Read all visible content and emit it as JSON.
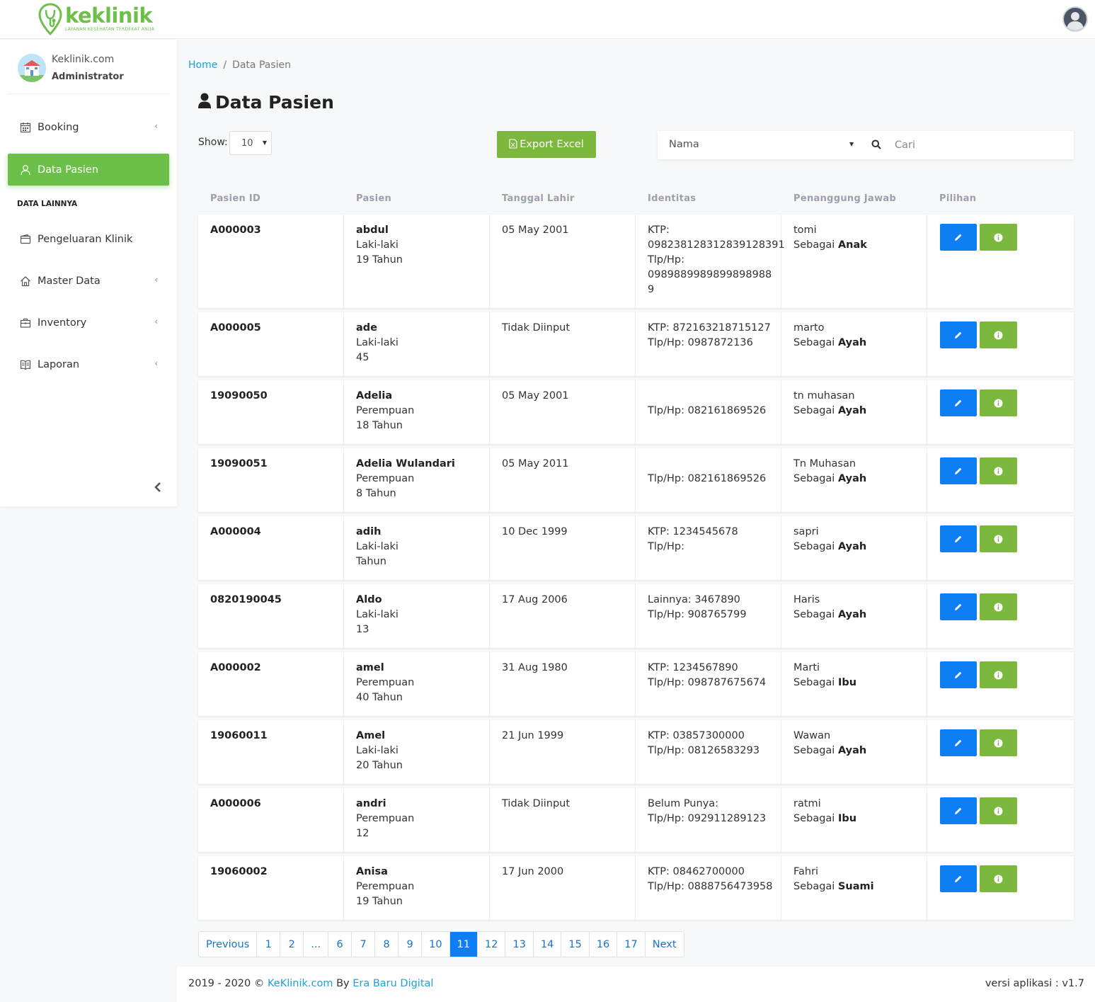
{
  "brand": {
    "name": "keklinik",
    "tagline": "LAYANAN KESEHATAN TERDEKAT ANDA"
  },
  "profile": {
    "name": "Keklinik.com",
    "role": "Administrator"
  },
  "sidebar": {
    "items": [
      {
        "label": "Booking",
        "icon": "calendar-icon",
        "has_chevron": true,
        "active": false
      },
      {
        "label": "Data Pasien",
        "icon": "user-icon",
        "has_chevron": false,
        "active": true
      },
      {
        "label": "Pengeluaran Klinik",
        "icon": "wallet-icon",
        "has_chevron": false,
        "active": false
      },
      {
        "label": "Master Data",
        "icon": "home-icon",
        "has_chevron": true,
        "active": false
      },
      {
        "label": "Inventory",
        "icon": "briefcase-icon",
        "has_chevron": true,
        "active": false
      },
      {
        "label": "Laporan",
        "icon": "book-icon",
        "has_chevron": true,
        "active": false
      }
    ],
    "section_label": "DATA LAINNYA"
  },
  "breadcrumb": {
    "home": "Home",
    "separator": "/",
    "current": "Data Pasien"
  },
  "page_title": "Data Pasien",
  "controls": {
    "show_label": "Show:",
    "show_value": "10",
    "export_label": "Export Excel",
    "search_field": "Nama",
    "search_placeholder": "Cari"
  },
  "table": {
    "headers": [
      "Pasien ID",
      "Pasien",
      "Tanggal Lahir",
      "Identitas",
      "Penanggung Jawab",
      "Pilihan"
    ],
    "rows": [
      {
        "id": "A000003",
        "name": "abdul",
        "gender": "Laki-laki",
        "age": "19 Tahun",
        "dob": "05 May 2001",
        "identity": [
          "KTP:",
          "098238128312839128391",
          "Tlp/Hp:",
          "0989889989899898988",
          "9"
        ],
        "guardian": "tomi",
        "relation_prefix": "Sebagai",
        "relation": "Anak"
      },
      {
        "id": "A000005",
        "name": "ade",
        "gender": "Laki-laki",
        "age": "45",
        "dob": "Tidak Diinput",
        "identity": [
          "KTP: 872163218715127",
          "Tlp/Hp: 0987872136"
        ],
        "guardian": "marto",
        "relation_prefix": "Sebagai",
        "relation": "Ayah"
      },
      {
        "id": "19090050",
        "name": "Adelia",
        "gender": "Perempuan",
        "age": "18 Tahun",
        "dob": "05 May 2001",
        "identity": [
          "",
          "Tlp/Hp: 082161869526"
        ],
        "guardian": "tn muhasan",
        "relation_prefix": "Sebagai",
        "relation": "Ayah"
      },
      {
        "id": "19090051",
        "name": "Adelia Wulandari",
        "gender": "Perempuan",
        "age": "8 Tahun",
        "dob": "05 May 2011",
        "identity": [
          "",
          "Tlp/Hp: 082161869526"
        ],
        "guardian": "Tn Muhasan",
        "relation_prefix": "Sebagai",
        "relation": "Ayah"
      },
      {
        "id": "A000004",
        "name": "adih",
        "gender": "Laki-laki",
        "age": "Tahun",
        "dob": "10 Dec 1999",
        "identity": [
          "KTP: 1234545678",
          "Tlp/Hp:"
        ],
        "guardian": "sapri",
        "relation_prefix": "Sebagai",
        "relation": "Ayah"
      },
      {
        "id": "0820190045",
        "name": "Aldo",
        "gender": "Laki-laki",
        "age": "13",
        "dob": "17 Aug 2006",
        "identity": [
          "Lainnya: 3467890",
          "Tlp/Hp: 908765799"
        ],
        "guardian": "Haris",
        "relation_prefix": "Sebagai",
        "relation": "Ayah"
      },
      {
        "id": "A000002",
        "name": "amel",
        "gender": "Perempuan",
        "age": "40 Tahun",
        "dob": "31 Aug 1980",
        "identity": [
          "KTP: 1234567890",
          "Tlp/Hp: 098787675674"
        ],
        "guardian": "Marti",
        "relation_prefix": "Sebagai",
        "relation": "Ibu"
      },
      {
        "id": "19060011",
        "name": "Amel",
        "gender": "Laki-laki",
        "age": "20 Tahun",
        "dob": "21 Jun 1999",
        "identity": [
          "KTP: 03857300000",
          "Tlp/Hp: 08126583293"
        ],
        "guardian": "Wawan",
        "relation_prefix": "Sebagai",
        "relation": "Ayah"
      },
      {
        "id": "A000006",
        "name": "andri",
        "gender": "Perempuan",
        "age": "12",
        "dob": "Tidak Diinput",
        "identity": [
          "Belum Punya:",
          "Tlp/Hp: 092911289123"
        ],
        "guardian": "ratmi",
        "relation_prefix": "Sebagai",
        "relation": "Ibu"
      },
      {
        "id": "19060002",
        "name": "Anisa",
        "gender": "Perempuan",
        "age": "19 Tahun",
        "dob": "17 Jun 2000",
        "identity": [
          "KTP: 08462700000",
          "Tlp/Hp: 0888756473958"
        ],
        "guardian": "Fahri",
        "relation_prefix": "Sebagai",
        "relation": "Suami"
      }
    ]
  },
  "pagination": {
    "pages": [
      "Previous",
      "1",
      "2",
      "...",
      "6",
      "7",
      "8",
      "9",
      "10",
      "11",
      "12",
      "13",
      "14",
      "15",
      "16",
      "17",
      "Next"
    ],
    "active": "11"
  },
  "footer": {
    "years": "2019 - 2020 ©",
    "site": "KeKlinik.com",
    "by": "By",
    "company": "Era Baru Digital",
    "version": "versi aplikasi : v1.7"
  },
  "colors": {
    "brand_green": "#6cc04a",
    "button_green": "#7cb73e",
    "primary_blue": "#0d7ff2",
    "link_blue": "#1aa3d8"
  }
}
